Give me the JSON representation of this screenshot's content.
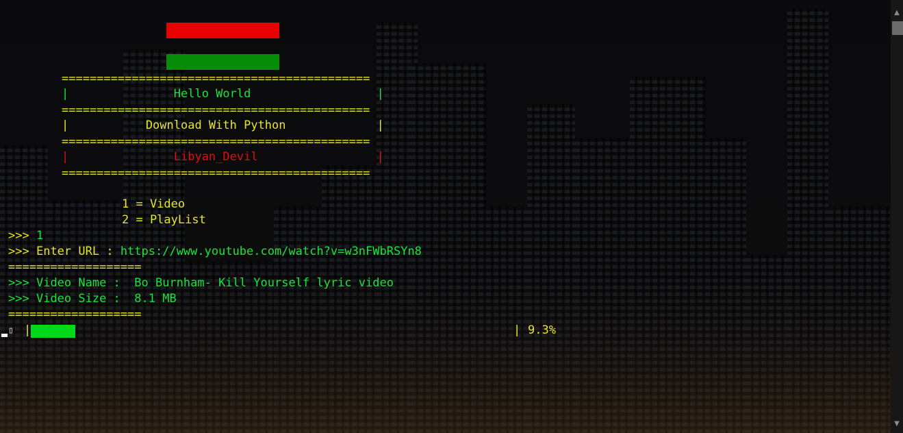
{
  "banner": {
    "flag_colors": [
      "#e60000",
      "#078c07"
    ],
    "border": "============================================",
    "rows": [
      {
        "text": "|               Hello World                  |",
        "color": "green"
      },
      {
        "text": "|           Download With Python             |",
        "color": "yellow"
      },
      {
        "text": "|               Libyan_Devil                 |",
        "color": "red"
      }
    ]
  },
  "menu": {
    "option_1": "1 = Video",
    "option_2": "2 = PlayList"
  },
  "session": {
    "prompt": ">>>",
    "choice": "1",
    "url_label": "Enter URL :",
    "url": "https://www.youtube.com/watch?v=w3nFWbRSYn8",
    "separator": "===================",
    "video_name_label": "Video Name :",
    "video_name": "Bo Burnham- Kill Yourself lyric video",
    "video_size_label": "Video Size :",
    "video_size": "8.1 MB"
  },
  "progress": {
    "spinner_glyph": "▯",
    "left_edge": "|",
    "right_edge": "|",
    "percent_text": "9.3%",
    "fraction": 0.093,
    "bar_color": "#00d91a"
  },
  "colors": {
    "yellow": "#e6e62a",
    "green": "#17e53b",
    "red": "#e01010",
    "background": "#0d0d10"
  },
  "scrollbar": {
    "up_icon": "▲",
    "down_icon": "▼"
  }
}
